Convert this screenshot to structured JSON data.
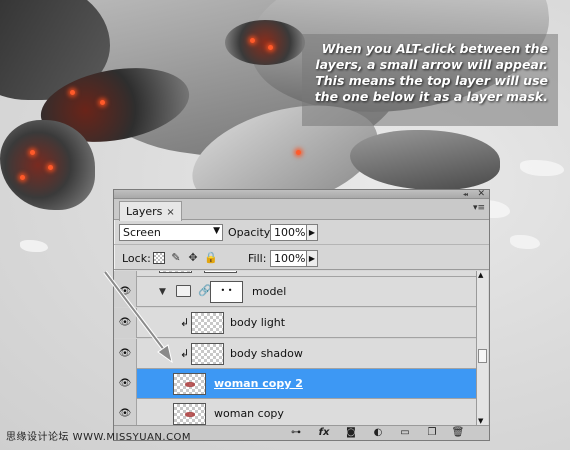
{
  "annotation": {
    "lines": [
      "When you ALT-click between the",
      "layers, a small arrow will appear.",
      "This means the top layer will use",
      "the one below it as a layer mask."
    ]
  },
  "panel": {
    "tab_label": "Layers",
    "tab_close": "×",
    "blend_mode": "Screen",
    "opacity_label": "Opacity:",
    "opacity_value": "100%",
    "lock_label": "Lock:",
    "fill_label": "Fill:",
    "fill_value": "100%",
    "layers": [
      {
        "name": "model",
        "type": "group"
      },
      {
        "name": "body light",
        "type": "clipped"
      },
      {
        "name": "body shadow",
        "type": "clipped"
      },
      {
        "name": "woman copy 2",
        "type": "layer",
        "selected": true
      },
      {
        "name": "woman copy",
        "type": "layer"
      }
    ]
  },
  "watermark": "思缘设计论坛  WWW.MISSYUAN.COM",
  "colors": {
    "selection": "#3d98f4",
    "panel_bg": "#d6d6d6"
  }
}
